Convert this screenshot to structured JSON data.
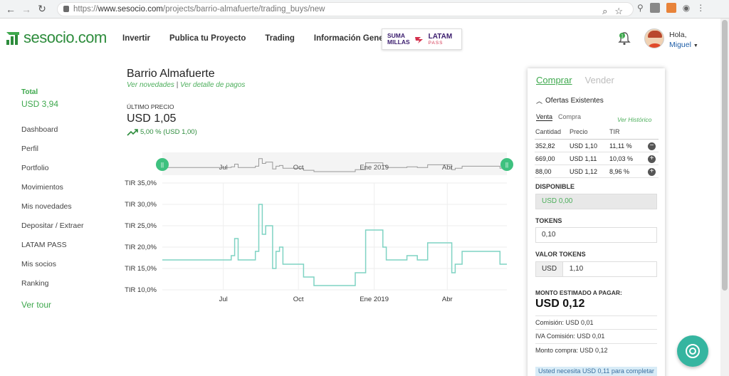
{
  "browser": {
    "url_scheme": "https://",
    "url_host": "www.sesocio.com",
    "url_path": "/projects/barrio-almafuerte/trading_buys/new"
  },
  "header": {
    "logo": "sesocio.com",
    "nav": [
      "Invertir",
      "Publica tu Proyecto",
      "Trading",
      "Información General"
    ],
    "promo": {
      "suma": "SUMA",
      "millas": "MILLAS",
      "latam": "LATAM",
      "pass": "PASS"
    },
    "greeting": "Hola,",
    "user_name": "Miguel"
  },
  "sidebar": {
    "total_label": "Total",
    "total_value": "USD 3,94",
    "items": [
      "Dashboard",
      "Perfil",
      "Portfolio",
      "Movimientos",
      "Mis novedades",
      "Depositar / Extraer",
      "LATAM PASS",
      "Mis socios",
      "Ranking"
    ],
    "tour": "Ver tour"
  },
  "project": {
    "title": "Barrio Almafuerte",
    "link_novedades": "Ver novedades",
    "link_pagos": "Ver detalle de pagos",
    "ultimo_label": "ÚLTIMO PRECIO",
    "price": "USD 1,05",
    "change": "5,00 % (USD 1,00)"
  },
  "chart_data": {
    "type": "line",
    "title": "",
    "xlabel": "",
    "ylabel": "",
    "x_ticks": [
      "Jul",
      "Oct",
      "Ene 2019",
      "Abr"
    ],
    "y_ticks": [
      "TIR 10,0%",
      "TIR 15,0%",
      "TIR 20,0%",
      "TIR 25,0%",
      "TIR 30,0%",
      "TIR 35,0%"
    ],
    "ylim": [
      10,
      35
    ],
    "xlim": [
      0,
      100
    ],
    "grid": true,
    "color": "#7fd3c3",
    "series": [
      {
        "points": [
          [
            0,
            17
          ],
          [
            20,
            17
          ],
          [
            20,
            18
          ],
          [
            21,
            18
          ],
          [
            21,
            22
          ],
          [
            22,
            22
          ],
          [
            22,
            17
          ],
          [
            27,
            17
          ],
          [
            27,
            19
          ],
          [
            28,
            19
          ],
          [
            28,
            30
          ],
          [
            29,
            30
          ],
          [
            29,
            23
          ],
          [
            30,
            23
          ],
          [
            30,
            25
          ],
          [
            32,
            25
          ],
          [
            32,
            15
          ],
          [
            33,
            15
          ],
          [
            33,
            19
          ],
          [
            34,
            19
          ],
          [
            34,
            20
          ],
          [
            35,
            20
          ],
          [
            35,
            16
          ],
          [
            41,
            16
          ],
          [
            41,
            13
          ],
          [
            44,
            13
          ],
          [
            44,
            11
          ],
          [
            56,
            11
          ],
          [
            56,
            14
          ],
          [
            59,
            14
          ],
          [
            59,
            24
          ],
          [
            64,
            24
          ],
          [
            64,
            20
          ],
          [
            65,
            20
          ],
          [
            65,
            17
          ],
          [
            71,
            17
          ],
          [
            71,
            18
          ],
          [
            74,
            18
          ],
          [
            74,
            17
          ],
          [
            77,
            17
          ],
          [
            77,
            21
          ],
          [
            84,
            21
          ],
          [
            84,
            14
          ],
          [
            85,
            14
          ],
          [
            85,
            16
          ],
          [
            87,
            16
          ],
          [
            87,
            19
          ],
          [
            98,
            19
          ],
          [
            98,
            16
          ],
          [
            100,
            16
          ]
        ]
      }
    ]
  },
  "navigator": {
    "x_ticks": [
      "Jul",
      "Oct",
      "Ene 2019",
      "Abr"
    ],
    "handle_left": "||",
    "handle_right": "||"
  },
  "panel": {
    "tab_buy": "Comprar",
    "tab_sell": "Vender",
    "ofertas_title": "Ofertas Existentes",
    "sub_venta": "Venta",
    "sub_compra": "Compra",
    "ver_historico": "Ver Histórico",
    "columns": [
      "Cantidad",
      "Precio",
      "TIR"
    ],
    "rows": [
      {
        "cantidad": "352,82",
        "precio": "USD 1,10",
        "tir": "11,11 %",
        "action": "−"
      },
      {
        "cantidad": "669,00",
        "precio": "USD 1,11",
        "tir": "10,03 %",
        "action": "+"
      },
      {
        "cantidad": "88,00",
        "precio": "USD 1,12",
        "tir": "8,96 %",
        "action": "+"
      }
    ],
    "disponible_label": "DISPONIBLE",
    "disponible_value": "USD 0,00",
    "tokens_label": "TOKENS",
    "tokens_value": "0,10",
    "valor_label": "VALOR TOKENS",
    "valor_currency": "USD",
    "valor_value": "1,10",
    "monto_label": "MONTO ESTIMADO A PAGAR:",
    "monto_value": "USD 0,12",
    "comision": "Comisión: USD 0,01",
    "iva": "IVA Comisión: USD 0,01",
    "monto_compra": "Monto compra: USD 0,12",
    "notice": "Usted necesita USD 0,11 para completar"
  },
  "colors": {
    "brand_green": "#3ea84d",
    "line_teal": "#7fd3c3",
    "fab": "#35b5a0"
  }
}
